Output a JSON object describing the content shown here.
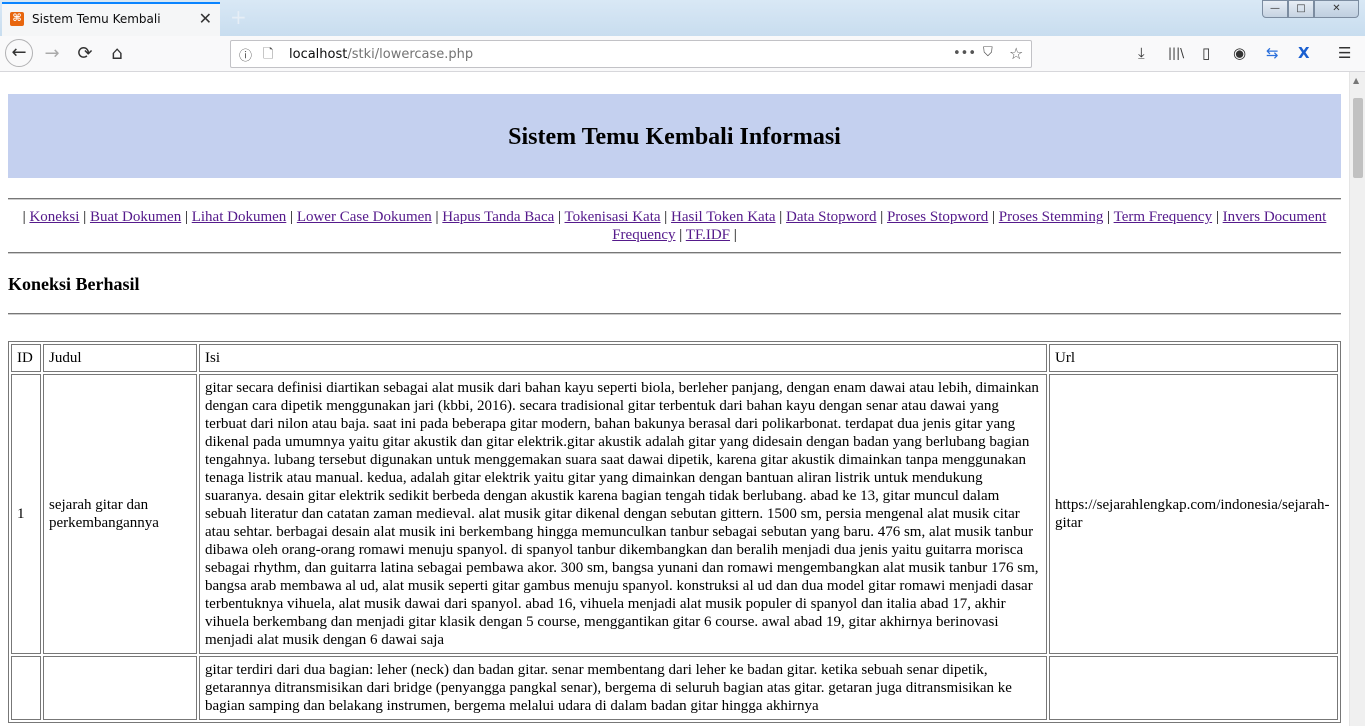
{
  "browser": {
    "tab_title": "Sistem Temu Kembali",
    "tab_close": "✕",
    "new_tab": "+",
    "url_host": "localhost",
    "url_path": "/stki/lowercase.php",
    "window_controls": {
      "minimize": "—",
      "maximize": "□",
      "close": "✕"
    },
    "nav_icons": {
      "back": "←",
      "forward": "→",
      "reload": "⟳",
      "home": "⌂"
    },
    "url_icons": {
      "info": "ⓘ",
      "page": "🗋",
      "more": "•••",
      "pocket": "⛉",
      "bookmark": "☆"
    },
    "toolbar_icons": {
      "download": "⤓",
      "library": "|||\\",
      "sidebar": "▯",
      "account": "◉",
      "translate": "⇆",
      "extension": "X",
      "menu": "☰"
    }
  },
  "page": {
    "heading": "Sistem Temu Kembali Informasi",
    "menu": {
      "items": [
        "Koneksi",
        "Buat Dokumen",
        "Lihat Dokumen",
        "Lower Case Dokumen",
        "Hapus Tanda Baca",
        "Tokenisasi Kata",
        "Hasil Token Kata",
        "Data Stopword",
        "Proses Stopword",
        "Proses Stemming",
        "Term Frequency",
        "Invers Document Frequency",
        "TF.IDF"
      ],
      "separator": "|"
    },
    "status": "Koneksi Berhasil",
    "table": {
      "headers": [
        "ID",
        "Judul",
        "Isi",
        "Url"
      ],
      "rows": [
        {
          "id": "1",
          "judul": "sejarah gitar dan perkembangannya",
          "isi": "gitar secara definisi diartikan sebagai alat musik dari bahan kayu seperti biola, berleher panjang, dengan enam dawai atau lebih, dimainkan dengan cara dipetik menggunakan jari (kbbi, 2016). secara tradisional gitar terbentuk dari bahan kayu dengan senar atau dawai yang terbuat dari nilon atau baja. saat ini pada beberapa gitar modern, bahan bakunya berasal dari polikarbonat. terdapat dua jenis gitar yang dikenal pada umumnya yaitu gitar akustik dan gitar elektrik.gitar akustik adalah gitar yang didesain dengan badan yang berlubang bagian tengahnya. lubang tersebut digunakan untuk menggemakan suara saat dawai dipetik, karena gitar akustik dimainkan tanpa menggunakan tenaga listrik atau manual. kedua, adalah gitar elektrik yaitu gitar yang dimainkan dengan bantuan aliran listrik untuk mendukung suaranya. desain gitar elektrik sedikit berbeda dengan akustik karena bagian tengah tidak berlubang. abad ke 13, gitar muncul dalam sebuah literatur dan catatan zaman medieval. alat musik gitar dikenal dengan sebutan gittern. 1500 sm, persia mengenal alat musik citar atau sehtar. berbagai desain alat musik ini berkembang hingga memunculkan tanbur sebagai sebutan yang baru. 476 sm, alat musik tanbur dibawa oleh orang-orang romawi menuju spanyol. di spanyol tanbur dikembangkan dan beralih menjadi dua jenis yaitu guitarra morisca sebagai rhythm, dan guitarra latina sebagai pembawa akor. 300 sm, bangsa yunani dan romawi mengembangkan alat musik tanbur 176 sm, bangsa arab membawa al ud, alat musik seperti gitar gambus menuju spanyol. konstruksi al ud dan dua model gitar romawi menjadi dasar terbentuknya vihuela, alat musik dawai dari spanyol. abad 16, vihuela menjadi alat musik populer di spanyol dan italia abad 17, akhir vihuela berkembang dan menjadi gitar klasik dengan 5 course, menggantikan gitar 6 course. awal abad 19, gitar akhirnya berinovasi menjadi alat musik dengan 6 dawai saja",
          "url": "https://sejarahlengkap.com/indonesia/sejarah-gitar"
        },
        {
          "id": "",
          "judul": "",
          "isi": "gitar terdiri dari dua bagian: leher (neck) dan badan gitar. senar membentang dari leher ke badan gitar. ketika sebuah senar dipetik, getarannya ditransmisikan dari bridge (penyangga pangkal senar), bergema di seluruh bagian atas gitar. getaran juga ditransmisikan ke bagian samping dan belakang instrumen, bergema melalui udara di dalam badan gitar hingga akhirnya",
          "url": ""
        }
      ]
    }
  }
}
